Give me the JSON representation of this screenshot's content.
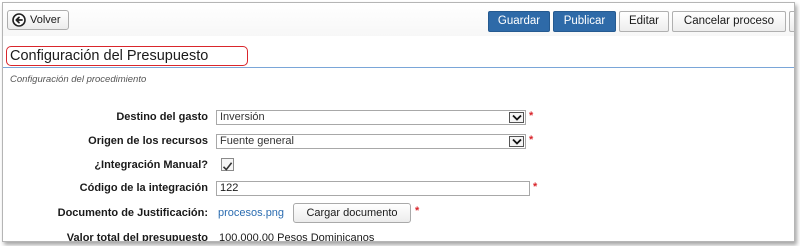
{
  "toolbar": {
    "back_label": "Volver",
    "save_label": "Guardar",
    "publish_label": "Publicar",
    "edit_label": "Editar",
    "cancel_label": "Cancelar proceso"
  },
  "page": {
    "title": "Configuración del Presupuesto",
    "subtitle": "Configuración del procedimiento"
  },
  "form": {
    "destino": {
      "label": "Destino del gasto",
      "value": "Inversión"
    },
    "origen": {
      "label": "Origen de los recursos",
      "value": "Fuente general"
    },
    "integracion_manual": {
      "label": "¿Integración Manual?",
      "checked": true
    },
    "codigo": {
      "label": "Código de la integración",
      "value": "122"
    },
    "documento": {
      "label": "Documento de Justificación:",
      "file": "procesos.png",
      "upload_label": "Cargar documento"
    },
    "valor_total": {
      "label": "Valor total del presupuesto",
      "value": "100,000.00 Pesos Dominicanos"
    },
    "required_mark": "*"
  },
  "colors": {
    "primary_button": "#2e6aa8",
    "required": "#d9262c",
    "highlight_border": "#d9262c",
    "link": "#2b6cb0"
  }
}
